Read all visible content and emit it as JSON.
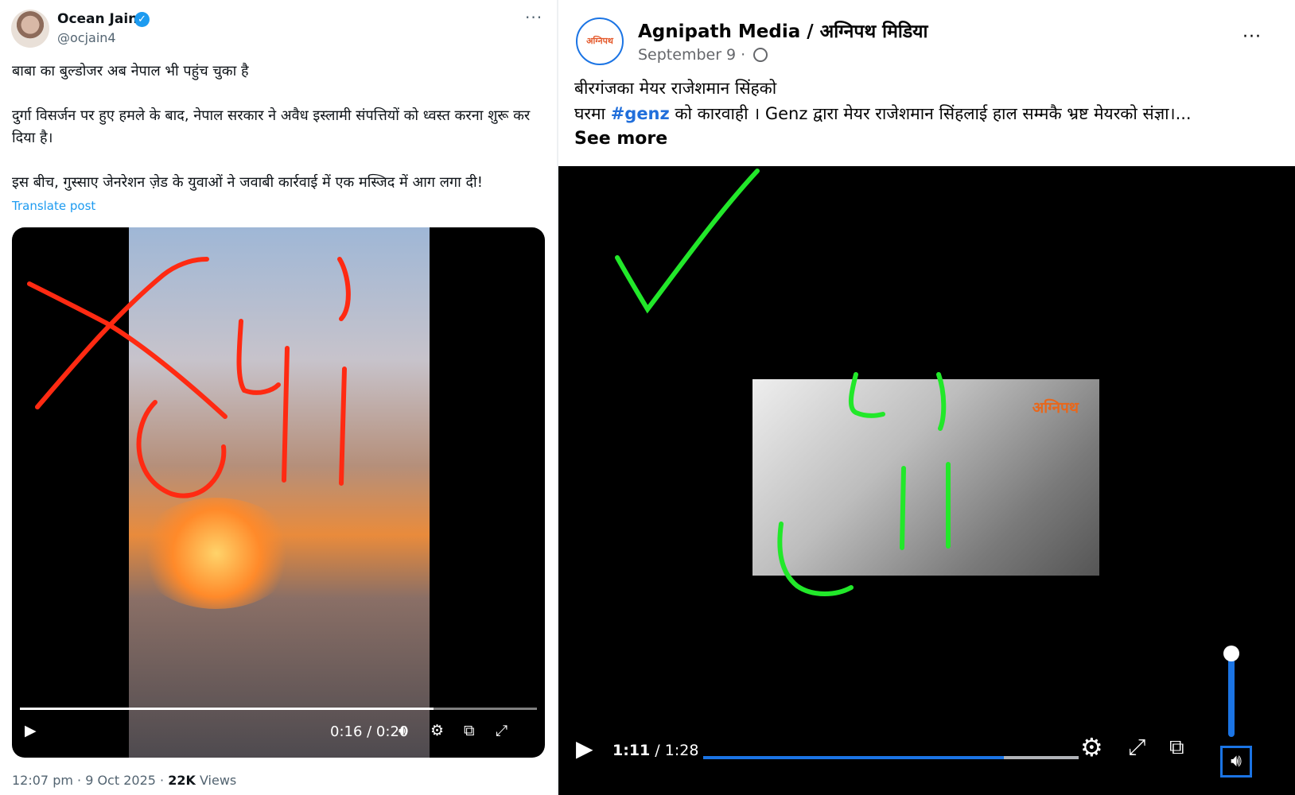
{
  "tweet": {
    "display_name": "Ocean Jain",
    "handle": "@ocjain4",
    "more_label": "···",
    "paragraphs": [
      "बाबा का बुल्डोजर अब नेपाल भी पहुंच चुका है",
      "दुर्गा विसर्जन पर हुए हमले के बाद, नेपाल सरकार ने अवैध इस्लामी संपत्तियों को ध्वस्त करना शुरू कर दिया है।",
      "इस बीच, गुस्साए जेनरेशन ज़ेड के युवाओं ने जवाबी कार्रवाई में एक मस्जिद में आग लगा दी!"
    ],
    "translate_label": "Translate post",
    "video": {
      "time": "0:16 / 0:20",
      "progress": 0.8
    },
    "footer": {
      "timestamp": "12:07 pm · 9 Oct 2025 · ",
      "views_count": "22K",
      "views_label": " Views"
    }
  },
  "fb_post": {
    "page_name": "Agnipath Media / अग्निपथ मिडिया",
    "avatar_text": "अग्निपथ",
    "date": "September 9 ·",
    "more_label": "···",
    "text_line1": "बीरगंजका मेयर राजेशमान सिंहको",
    "text_line2_prefix": "घरमा ",
    "hashtag": "#genz",
    "text_line2_suffix": " को कारवाही । Genz द्वारा मेयर राजेशमान सिंहलाई हाल सम्मकै भ्रष्ट मेयरको संज्ञा।...",
    "see_more": "See more",
    "video": {
      "current_time": "1:11",
      "total_time": " / 1:28",
      "progress": 0.8,
      "volume": 0.85,
      "watermark": "अग्निपथ"
    }
  },
  "annotations": {
    "left_color": "#ff2a12",
    "right_color": "#22e82a"
  }
}
